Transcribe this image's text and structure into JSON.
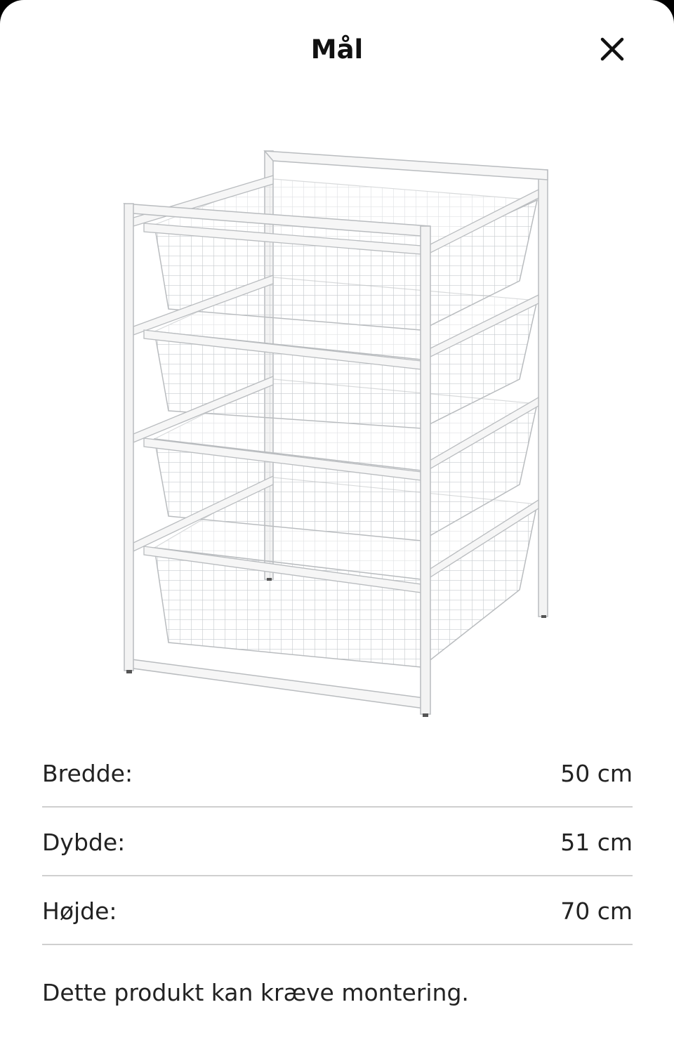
{
  "header": {
    "title": "Mål",
    "close_icon": "close-icon"
  },
  "product_image": {
    "alt": "Wire basket drawer frame with four baskets",
    "color": "#ffffff"
  },
  "dimensions": [
    {
      "label": "Bredde:",
      "value": "50 cm"
    },
    {
      "label": "Dybde:",
      "value": "51 cm"
    },
    {
      "label": "Højde:",
      "value": "70 cm"
    }
  ],
  "note": "Dette produkt kan kræve montering.",
  "colors": {
    "background": "#ffffff",
    "text": "#111111",
    "divider": "#cfcfcf"
  }
}
